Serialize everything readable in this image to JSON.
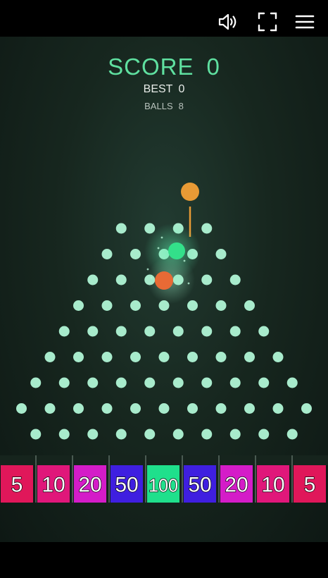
{
  "toolbar": {
    "icons": [
      "speaker-icon",
      "fullscreen-icon",
      "hamburger-menu-icon"
    ]
  },
  "hud": {
    "score_label": "SCORE",
    "score_value": "0",
    "best_label": "BEST",
    "best_value": "0",
    "balls_label": "BALLS",
    "balls_value": "8"
  },
  "board": {
    "peg_rows": [
      4,
      5,
      6,
      7,
      8,
      9,
      10,
      11,
      10
    ],
    "buckets": [
      {
        "label": "5",
        "color": "#e0175a"
      },
      {
        "label": "10",
        "color": "#e0177a"
      },
      {
        "label": "20",
        "color": "#d41cc8"
      },
      {
        "label": "50",
        "color": "#3f1fe0"
      },
      {
        "label": "100",
        "color": "#1fe08c"
      },
      {
        "label": "50",
        "color": "#3f1fe0"
      },
      {
        "label": "20",
        "color": "#d41cc8"
      },
      {
        "label": "10",
        "color": "#e0177a"
      },
      {
        "label": "5",
        "color": "#e0175a"
      }
    ],
    "colors": {
      "peg": "#a8ebcc",
      "launcher_ball": "#e89a35",
      "ball_green": "#33e08a",
      "ball_orange": "#e86a35"
    }
  }
}
